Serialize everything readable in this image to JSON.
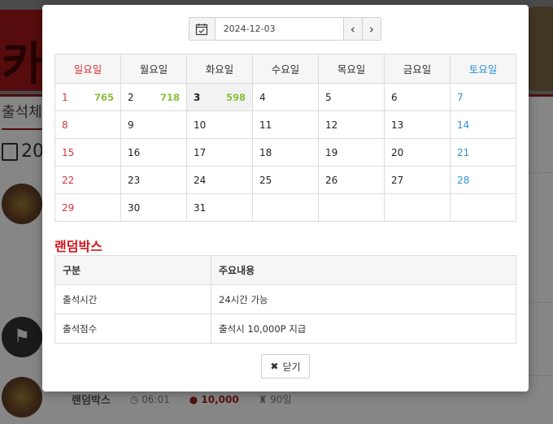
{
  "background": {
    "logo_text": "카",
    "page_title": "출석체",
    "calendar_year_partial": "20",
    "bottom_row": {
      "name": "랜덤박스",
      "time": "06:01",
      "points": "10,000",
      "days": "90일"
    }
  },
  "modal": {
    "date_value": "2024-12-03",
    "prev_label": "‹",
    "next_label": "›",
    "weekdays": [
      "일요일",
      "월요일",
      "화요일",
      "수요일",
      "목요일",
      "금요일",
      "토요일"
    ],
    "weeks": [
      [
        {
          "d": "1",
          "p": "765"
        },
        {
          "d": "2",
          "p": "718"
        },
        {
          "d": "3",
          "p": "598",
          "today": true
        },
        {
          "d": "4"
        },
        {
          "d": "5"
        },
        {
          "d": "6"
        },
        {
          "d": "7"
        }
      ],
      [
        {
          "d": "8"
        },
        {
          "d": "9"
        },
        {
          "d": "10"
        },
        {
          "d": "11"
        },
        {
          "d": "12"
        },
        {
          "d": "13"
        },
        {
          "d": "14"
        }
      ],
      [
        {
          "d": "15"
        },
        {
          "d": "16"
        },
        {
          "d": "17"
        },
        {
          "d": "18"
        },
        {
          "d": "19"
        },
        {
          "d": "20"
        },
        {
          "d": "21"
        }
      ],
      [
        {
          "d": "22"
        },
        {
          "d": "23"
        },
        {
          "d": "24"
        },
        {
          "d": "25"
        },
        {
          "d": "26"
        },
        {
          "d": "27"
        },
        {
          "d": "28"
        }
      ],
      [
        {
          "d": "29"
        },
        {
          "d": "30"
        },
        {
          "d": "31"
        },
        {
          "d": ""
        },
        {
          "d": ""
        },
        {
          "d": ""
        },
        {
          "d": ""
        }
      ]
    ],
    "section_title": "랜덤박스",
    "info_headers": [
      "구분",
      "주요내용"
    ],
    "info_rows": [
      [
        "출석시간",
        "24시간 가능"
      ],
      [
        "출석점수",
        "출석시 10,000P 지급"
      ]
    ],
    "close_label": "닫기"
  },
  "colors": {
    "sunday": "#d4343c",
    "saturday": "#2b93d3",
    "points": "#8bbe3b",
    "section_title": "#d4141a"
  }
}
